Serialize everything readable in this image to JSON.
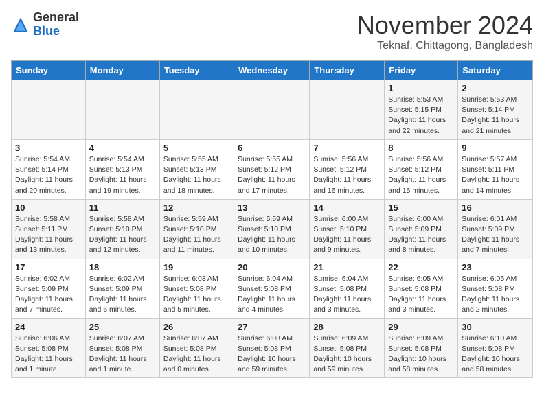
{
  "header": {
    "logo_general": "General",
    "logo_blue": "Blue",
    "month_title": "November 2024",
    "location": "Teknaf, Chittagong, Bangladesh"
  },
  "weekdays": [
    "Sunday",
    "Monday",
    "Tuesday",
    "Wednesday",
    "Thursday",
    "Friday",
    "Saturday"
  ],
  "weeks": [
    [
      {
        "day": "",
        "sunrise": "",
        "sunset": "",
        "daylight": ""
      },
      {
        "day": "",
        "sunrise": "",
        "sunset": "",
        "daylight": ""
      },
      {
        "day": "",
        "sunrise": "",
        "sunset": "",
        "daylight": ""
      },
      {
        "day": "",
        "sunrise": "",
        "sunset": "",
        "daylight": ""
      },
      {
        "day": "",
        "sunrise": "",
        "sunset": "",
        "daylight": ""
      },
      {
        "day": "1",
        "sunrise": "Sunrise: 5:53 AM",
        "sunset": "Sunset: 5:15 PM",
        "daylight": "Daylight: 11 hours and 22 minutes."
      },
      {
        "day": "2",
        "sunrise": "Sunrise: 5:53 AM",
        "sunset": "Sunset: 5:14 PM",
        "daylight": "Daylight: 11 hours and 21 minutes."
      }
    ],
    [
      {
        "day": "3",
        "sunrise": "Sunrise: 5:54 AM",
        "sunset": "Sunset: 5:14 PM",
        "daylight": "Daylight: 11 hours and 20 minutes."
      },
      {
        "day": "4",
        "sunrise": "Sunrise: 5:54 AM",
        "sunset": "Sunset: 5:13 PM",
        "daylight": "Daylight: 11 hours and 19 minutes."
      },
      {
        "day": "5",
        "sunrise": "Sunrise: 5:55 AM",
        "sunset": "Sunset: 5:13 PM",
        "daylight": "Daylight: 11 hours and 18 minutes."
      },
      {
        "day": "6",
        "sunrise": "Sunrise: 5:55 AM",
        "sunset": "Sunset: 5:12 PM",
        "daylight": "Daylight: 11 hours and 17 minutes."
      },
      {
        "day": "7",
        "sunrise": "Sunrise: 5:56 AM",
        "sunset": "Sunset: 5:12 PM",
        "daylight": "Daylight: 11 hours and 16 minutes."
      },
      {
        "day": "8",
        "sunrise": "Sunrise: 5:56 AM",
        "sunset": "Sunset: 5:12 PM",
        "daylight": "Daylight: 11 hours and 15 minutes."
      },
      {
        "day": "9",
        "sunrise": "Sunrise: 5:57 AM",
        "sunset": "Sunset: 5:11 PM",
        "daylight": "Daylight: 11 hours and 14 minutes."
      }
    ],
    [
      {
        "day": "10",
        "sunrise": "Sunrise: 5:58 AM",
        "sunset": "Sunset: 5:11 PM",
        "daylight": "Daylight: 11 hours and 13 minutes."
      },
      {
        "day": "11",
        "sunrise": "Sunrise: 5:58 AM",
        "sunset": "Sunset: 5:10 PM",
        "daylight": "Daylight: 11 hours and 12 minutes."
      },
      {
        "day": "12",
        "sunrise": "Sunrise: 5:59 AM",
        "sunset": "Sunset: 5:10 PM",
        "daylight": "Daylight: 11 hours and 11 minutes."
      },
      {
        "day": "13",
        "sunrise": "Sunrise: 5:59 AM",
        "sunset": "Sunset: 5:10 PM",
        "daylight": "Daylight: 11 hours and 10 minutes."
      },
      {
        "day": "14",
        "sunrise": "Sunrise: 6:00 AM",
        "sunset": "Sunset: 5:10 PM",
        "daylight": "Daylight: 11 hours and 9 minutes."
      },
      {
        "day": "15",
        "sunrise": "Sunrise: 6:00 AM",
        "sunset": "Sunset: 5:09 PM",
        "daylight": "Daylight: 11 hours and 8 minutes."
      },
      {
        "day": "16",
        "sunrise": "Sunrise: 6:01 AM",
        "sunset": "Sunset: 5:09 PM",
        "daylight": "Daylight: 11 hours and 7 minutes."
      }
    ],
    [
      {
        "day": "17",
        "sunrise": "Sunrise: 6:02 AM",
        "sunset": "Sunset: 5:09 PM",
        "daylight": "Daylight: 11 hours and 7 minutes."
      },
      {
        "day": "18",
        "sunrise": "Sunrise: 6:02 AM",
        "sunset": "Sunset: 5:09 PM",
        "daylight": "Daylight: 11 hours and 6 minutes."
      },
      {
        "day": "19",
        "sunrise": "Sunrise: 6:03 AM",
        "sunset": "Sunset: 5:08 PM",
        "daylight": "Daylight: 11 hours and 5 minutes."
      },
      {
        "day": "20",
        "sunrise": "Sunrise: 6:04 AM",
        "sunset": "Sunset: 5:08 PM",
        "daylight": "Daylight: 11 hours and 4 minutes."
      },
      {
        "day": "21",
        "sunrise": "Sunrise: 6:04 AM",
        "sunset": "Sunset: 5:08 PM",
        "daylight": "Daylight: 11 hours and 3 minutes."
      },
      {
        "day": "22",
        "sunrise": "Sunrise: 6:05 AM",
        "sunset": "Sunset: 5:08 PM",
        "daylight": "Daylight: 11 hours and 3 minutes."
      },
      {
        "day": "23",
        "sunrise": "Sunrise: 6:05 AM",
        "sunset": "Sunset: 5:08 PM",
        "daylight": "Daylight: 11 hours and 2 minutes."
      }
    ],
    [
      {
        "day": "24",
        "sunrise": "Sunrise: 6:06 AM",
        "sunset": "Sunset: 5:08 PM",
        "daylight": "Daylight: 11 hours and 1 minute."
      },
      {
        "day": "25",
        "sunrise": "Sunrise: 6:07 AM",
        "sunset": "Sunset: 5:08 PM",
        "daylight": "Daylight: 11 hours and 1 minute."
      },
      {
        "day": "26",
        "sunrise": "Sunrise: 6:07 AM",
        "sunset": "Sunset: 5:08 PM",
        "daylight": "Daylight: 11 hours and 0 minutes."
      },
      {
        "day": "27",
        "sunrise": "Sunrise: 6:08 AM",
        "sunset": "Sunset: 5:08 PM",
        "daylight": "Daylight: 10 hours and 59 minutes."
      },
      {
        "day": "28",
        "sunrise": "Sunrise: 6:09 AM",
        "sunset": "Sunset: 5:08 PM",
        "daylight": "Daylight: 10 hours and 59 minutes."
      },
      {
        "day": "29",
        "sunrise": "Sunrise: 6:09 AM",
        "sunset": "Sunset: 5:08 PM",
        "daylight": "Daylight: 10 hours and 58 minutes."
      },
      {
        "day": "30",
        "sunrise": "Sunrise: 6:10 AM",
        "sunset": "Sunset: 5:08 PM",
        "daylight": "Daylight: 10 hours and 58 minutes."
      }
    ]
  ]
}
